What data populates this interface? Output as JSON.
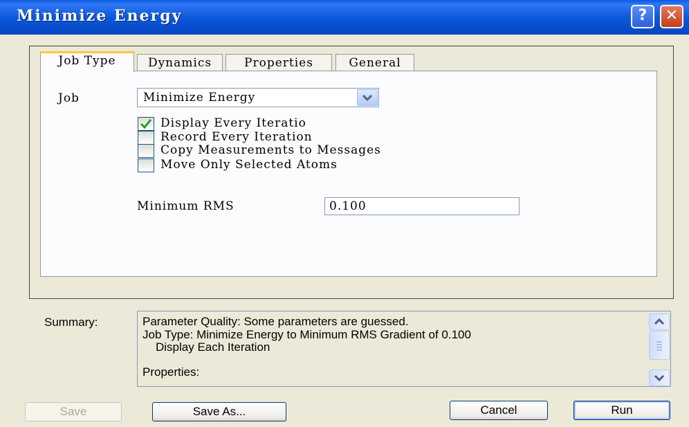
{
  "window": {
    "title": "Minimize Energy",
    "help_label": "?",
    "close_label": "✕"
  },
  "tabs": [
    {
      "label": "Job Type",
      "active": true
    },
    {
      "label": "Dynamics",
      "active": false
    },
    {
      "label": "Properties",
      "active": false
    },
    {
      "label": "General",
      "active": false
    }
  ],
  "job": {
    "label": "Job",
    "selected": "Minimize Energy"
  },
  "options": [
    {
      "label": "Display Every Iteratio",
      "checked": true
    },
    {
      "label": "Record Every Iteration",
      "checked": false
    },
    {
      "label": "Copy Measurements to Messages",
      "checked": false
    },
    {
      "label": "Move Only Selected Atoms",
      "checked": false
    }
  ],
  "min_rms": {
    "label": "Minimum RMS",
    "value": "0.100"
  },
  "summary": {
    "label": "Summary:",
    "lines": [
      "Parameter Quality: Some parameters are guessed.",
      "Job Type: Minimize Energy to Minimum RMS Gradient of 0.100",
      "   Display Each Iteration",
      "",
      "Properties:"
    ]
  },
  "buttons": {
    "save": "Save",
    "save_as": "Save As...",
    "cancel": "Cancel",
    "run": "Run"
  },
  "icons": {
    "checkmark": "check-icon",
    "dropdown": "chevron-down-icon",
    "scroll_up": "chevron-up-icon",
    "scroll_down": "chevron-down-icon",
    "scroll_grip": "grip-icon"
  },
  "colors": {
    "title_bar": "#0a56d8",
    "dialog_bg": "#ece9d8",
    "active_tab_accent": "#ffc83c",
    "checkmark": "#21a121"
  }
}
